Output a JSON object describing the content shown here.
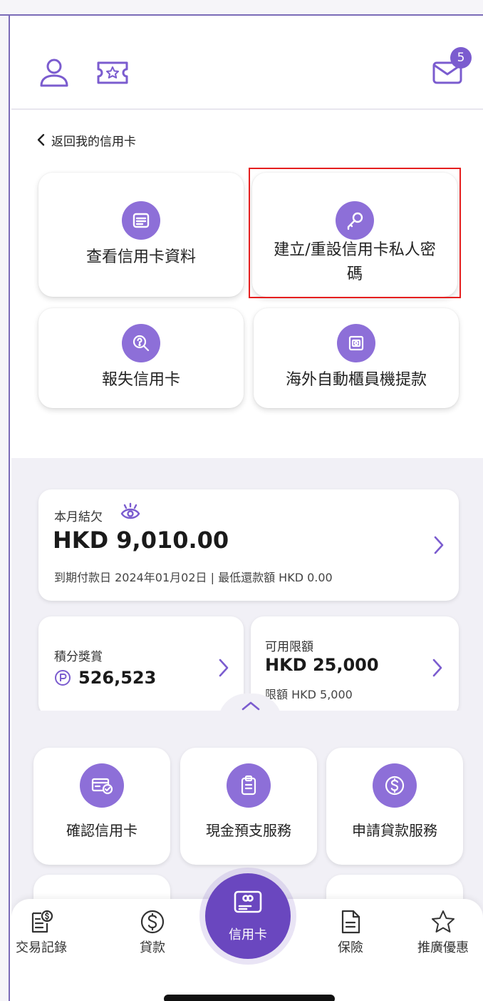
{
  "header": {
    "mail_badge_count": "5",
    "icons": [
      "user-icon",
      "ticket-star-icon",
      "mail-icon"
    ]
  },
  "nav": {
    "back_label": "返回我的信用卡"
  },
  "actions": [
    {
      "label": "查看信用卡資料",
      "icon": "card-list-icon"
    },
    {
      "label": "建立/重設信用卡私人密碼",
      "icon": "key-icon",
      "highlighted": true
    },
    {
      "label": "報失信用卡",
      "icon": "search-question-icon"
    },
    {
      "label": "海外自動櫃員機提款",
      "icon": "atm-icon"
    }
  ],
  "statement": {
    "label": "本月結欠",
    "amount": "HKD 9,010.00",
    "due_info": "到期付款日 2024年01月02日 | 最低還款額 HKD 0.00"
  },
  "rewards": {
    "label": "積分獎賞",
    "points": "526,523"
  },
  "limit": {
    "label": "可用限額",
    "available": "HKD 25,000",
    "total": "限額 HKD 5,000"
  },
  "services": [
    {
      "label": "確認信用卡",
      "icon": "card-check-icon"
    },
    {
      "label": "現金預支服務",
      "icon": "clipboard-icon"
    },
    {
      "label": "申請貸款服務",
      "icon": "dollar-circle-icon"
    }
  ],
  "bottom_nav": [
    {
      "label": "交易記錄",
      "icon": "transaction-icon"
    },
    {
      "label": "貸款",
      "icon": "dollar-icon"
    },
    {
      "label": "信用卡",
      "icon": "credit-card-icon",
      "active": true
    },
    {
      "label": "保險",
      "icon": "document-icon"
    },
    {
      "label": "推廣優惠",
      "icon": "star-icon"
    }
  ],
  "colors": {
    "accent": "#7b5ccf",
    "highlight_border": "#e51f1f",
    "summary_bg": "#f1f0f6"
  }
}
